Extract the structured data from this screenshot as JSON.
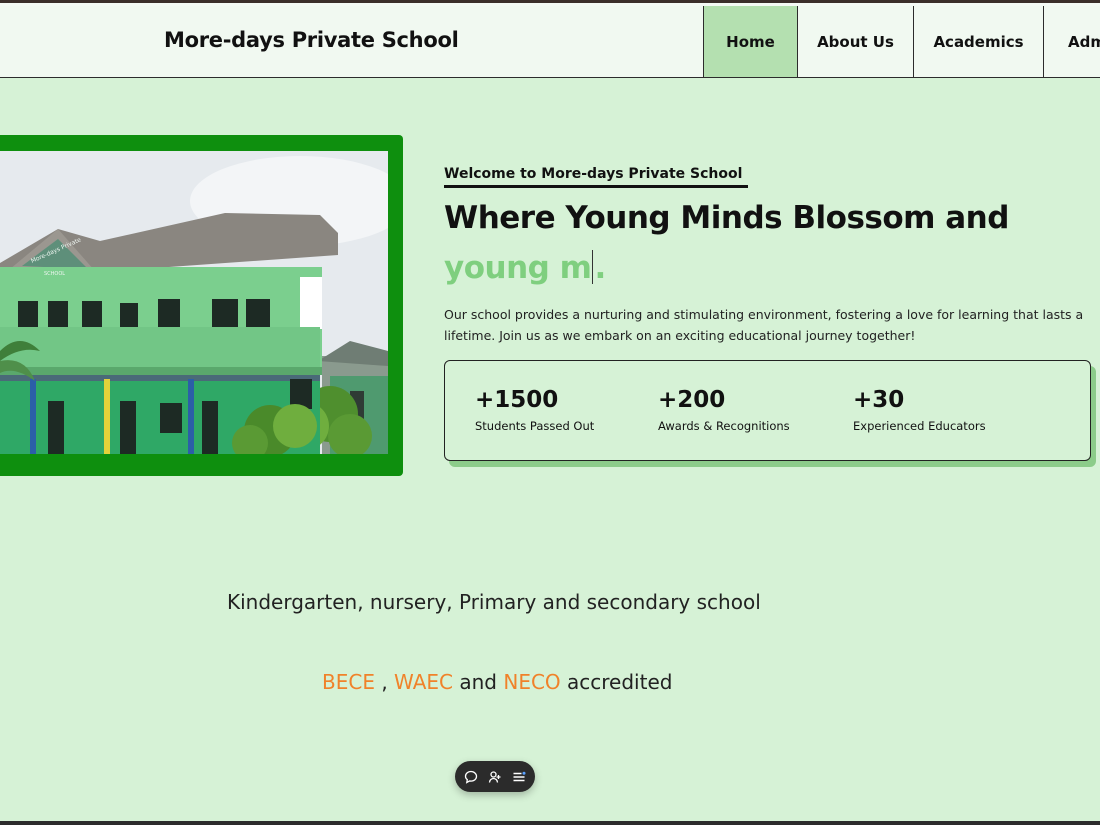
{
  "header": {
    "brand": "More-days Private School"
  },
  "nav": {
    "items": [
      {
        "label": "Home"
      },
      {
        "label": "About Us"
      },
      {
        "label": "Academics"
      },
      {
        "label": "Admissions"
      }
    ]
  },
  "hero": {
    "welcome": "Welcome to More-days Private School",
    "headline": "Where Young Minds Blossom and",
    "typed_before_caret": "young m",
    "typed_after_caret": ".",
    "description": "Our school provides a nurturing and stimulating environment, fostering a love for learning that lasts a lifetime. Join us as we embark on an exciting educational journey together!",
    "image_sign": "More-days Private School",
    "stats": [
      {
        "value": "+1500",
        "label": "Students Passed Out"
      },
      {
        "value": "+200",
        "label": "Awards & Recognitions"
      },
      {
        "value": "+30",
        "label": "Experienced Educators"
      }
    ]
  },
  "info": {
    "levels": "Kindergarten, nursery, Primary and secondary school",
    "bodies": [
      "BECE",
      "WAEC",
      "NECO"
    ],
    "sep1": " , ",
    "sep2": " and ",
    "tail": " accredited"
  },
  "colors": {
    "background": "#d6f2d6",
    "frame": "#0e8f0e",
    "active_nav": "#b4e0b0",
    "typed": "#7fcf7f",
    "accent": "#f0822a"
  },
  "toolbar": {
    "icons": [
      "chat-icon",
      "user-add-icon",
      "menu-list-icon"
    ]
  }
}
